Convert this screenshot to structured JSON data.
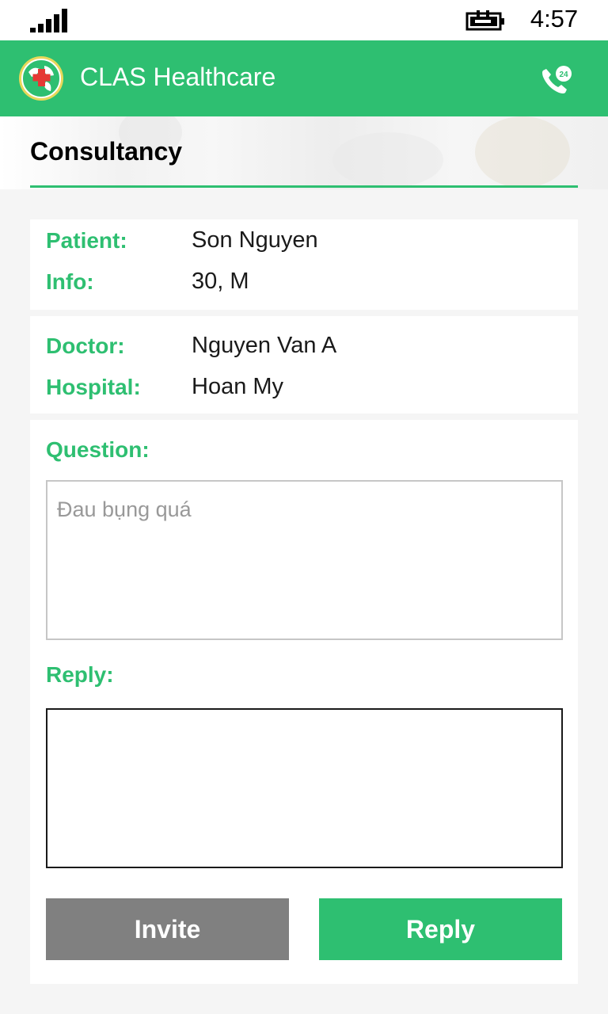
{
  "status_bar": {
    "time": "4:57",
    "signal_icon": "signal-bars-icon",
    "battery_icon": "battery-charging-icon"
  },
  "header": {
    "app_title": "CLAS Healthcare",
    "logo_icon": "globe-medical-cross-icon",
    "call_icon": "phone-24h-icon",
    "accent_color": "#2ebf71"
  },
  "page": {
    "title": "Consultancy"
  },
  "patient": {
    "patient_label": "Patient:",
    "patient_value": "Son Nguyen",
    "info_label": "Info:",
    "info_value": "30, M"
  },
  "doctor": {
    "doctor_label": "Doctor:",
    "doctor_value": "Nguyen Van A",
    "hospital_label": "Hospital:",
    "hospital_value": "Hoan My"
  },
  "consult": {
    "question_label": "Question:",
    "question_text": "Đau bụng quá",
    "reply_label": "Reply:",
    "reply_text": ""
  },
  "actions": {
    "invite_label": "Invite",
    "reply_label": "Reply"
  }
}
